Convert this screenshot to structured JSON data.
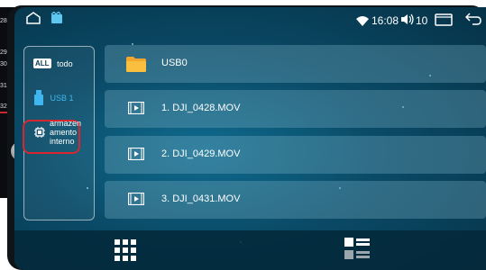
{
  "background_doc": {
    "line_numbers": [
      "28",
      "29",
      "30",
      "31",
      "32"
    ]
  },
  "status_bar": {
    "time": "16:08",
    "volume": "10",
    "icons": [
      "home-outline-icon",
      "video-app-icon",
      "wifi-icon",
      "volume-icon",
      "recent-apps-icon",
      "back-arrow-icon"
    ]
  },
  "sources": [
    {
      "icon": "all-badge-icon",
      "badge": "ALL",
      "label": "todo"
    },
    {
      "icon": "usb-icon",
      "label": "USB 1"
    },
    {
      "icon": "chip-icon",
      "label": "armazen amento interno"
    }
  ],
  "selected_source": "USB 1",
  "highlight_color": "#d7262e",
  "files": [
    {
      "icon": "folder-icon",
      "label": "USB0"
    },
    {
      "icon": "video-file-icon",
      "label": "1.  DJI_0428.MOV"
    },
    {
      "icon": "video-file-icon",
      "label": "2.  DJI_0429.MOV"
    },
    {
      "icon": "video-file-icon",
      "label": "3.  DJI_0431.MOV"
    }
  ],
  "bottom_bar": {
    "buttons": [
      "grid-view-icon",
      "list-view-icon"
    ]
  }
}
